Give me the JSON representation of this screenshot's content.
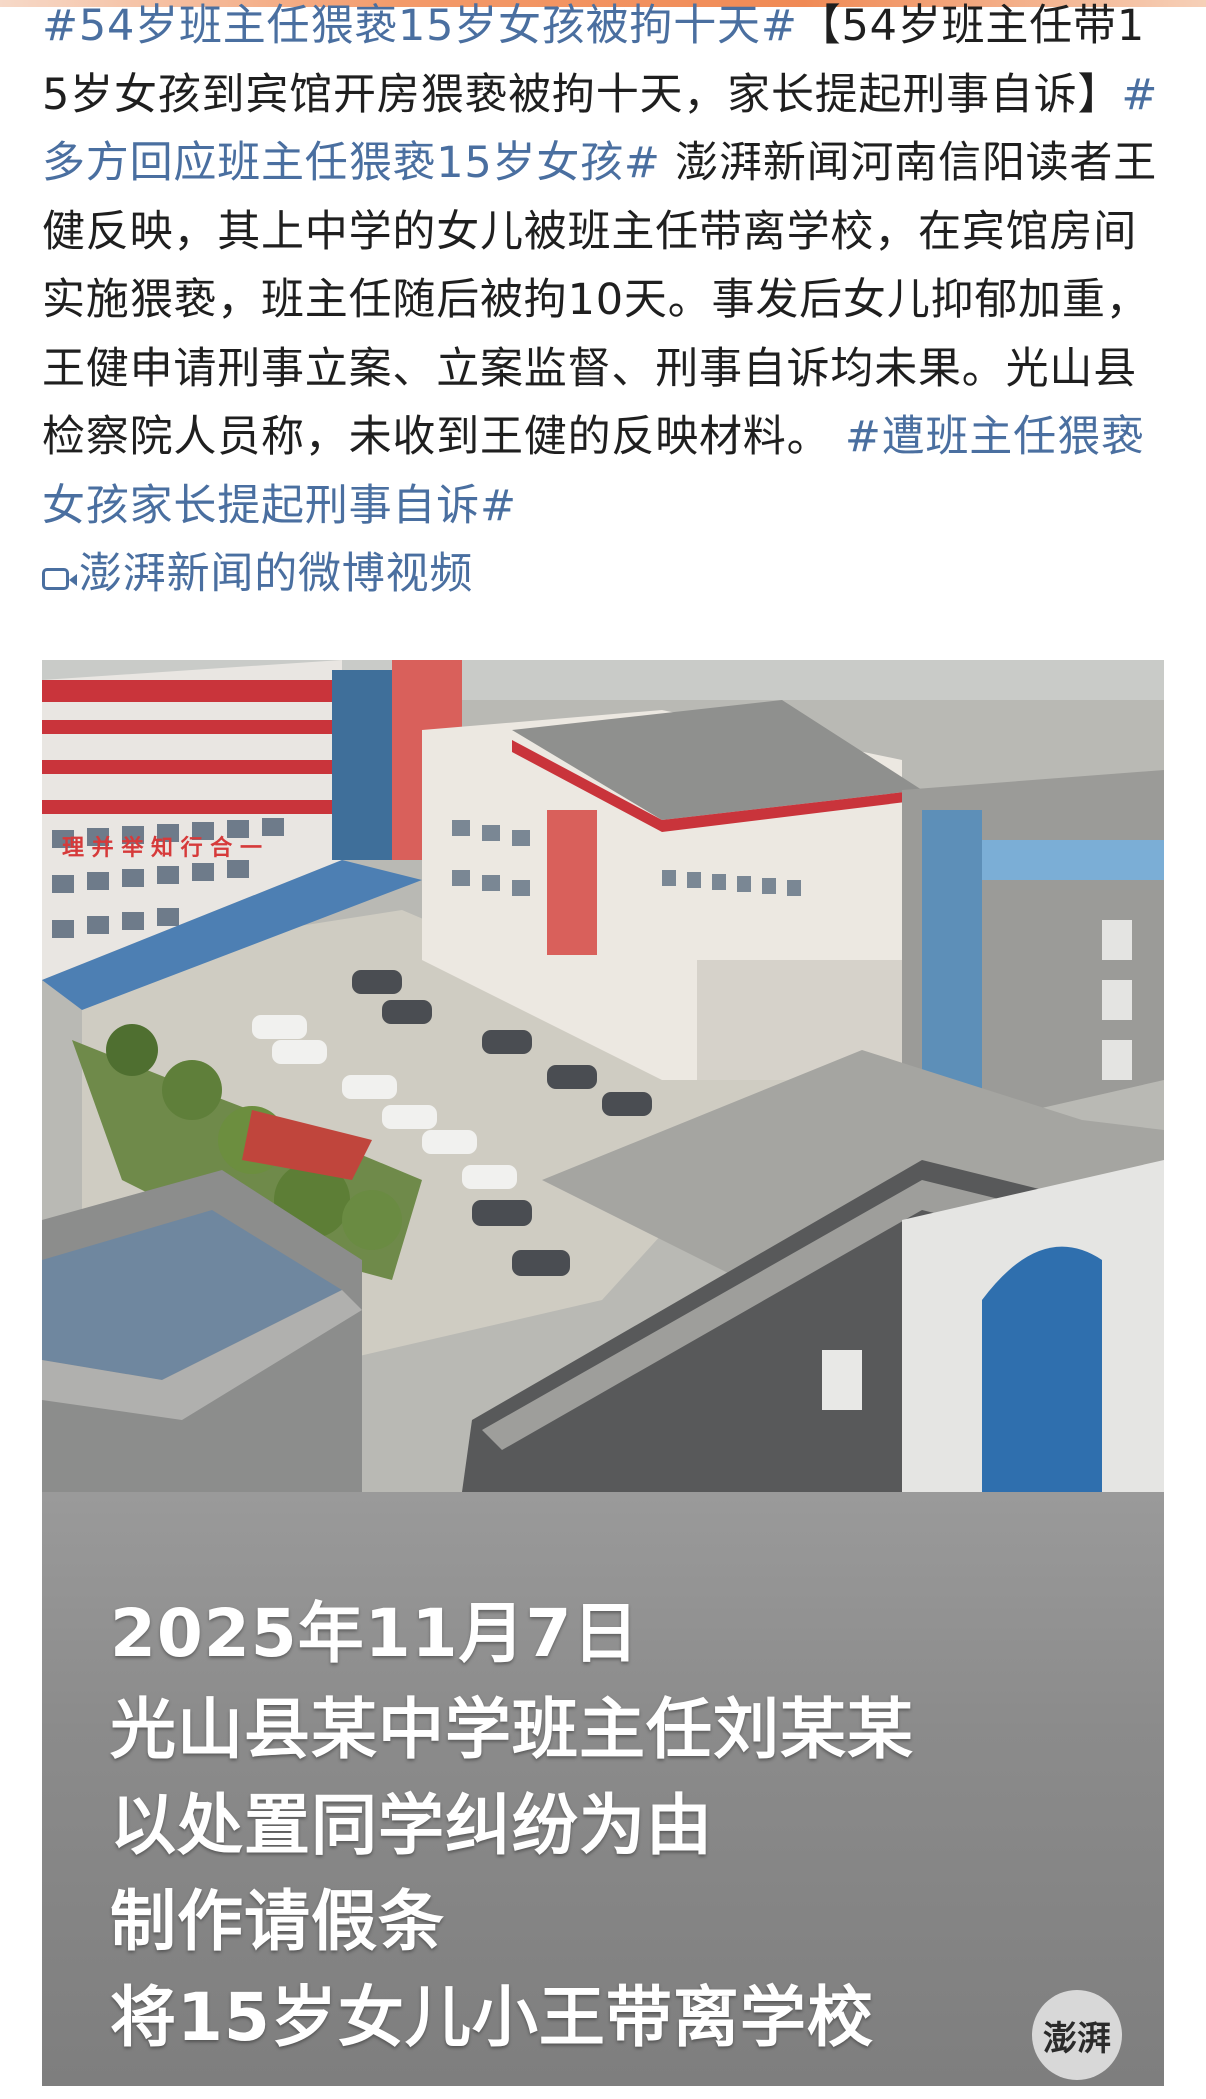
{
  "post": {
    "hashtag_1": "#54岁班主任猥亵15岁女孩被拘十天#",
    "headline": "【54岁班主任带15岁女孩到宾馆开房猥亵被拘十天，家长提起刑事自诉】",
    "hashtag_2": "#多方回应班主任猥亵15岁女孩#",
    "body": " 澎湃新闻河南信阳读者王健反映，其上中学的女儿被班主任带离学校，在宾馆房间实施猥亵，班主任随后被拘10天。事发后女儿抑郁加重，王健申请刑事立案、立案监督、刑事自诉均未果。光山县检察院人员称，未收到王健的反映材料。 ",
    "hashtag_3": "#遭班主任猥亵女孩家长提起刑事自诉#",
    "video_link": "澎湃新闻的微博视频",
    "video_icon": "video-camera-icon"
  },
  "media": {
    "building_sign": "理 并 举 知 行 合 一",
    "caption_lines": [
      "2025年11月7日",
      "光山县某中学班主任刘某某",
      "以处置同学纠纷为由",
      "制作请假条",
      "将15岁女儿小王带离学校"
    ],
    "watermark": "澎湃"
  },
  "colors": {
    "link": "#4a6fa0",
    "text": "#1f1f1f",
    "accent_bar": "#f08a55"
  }
}
